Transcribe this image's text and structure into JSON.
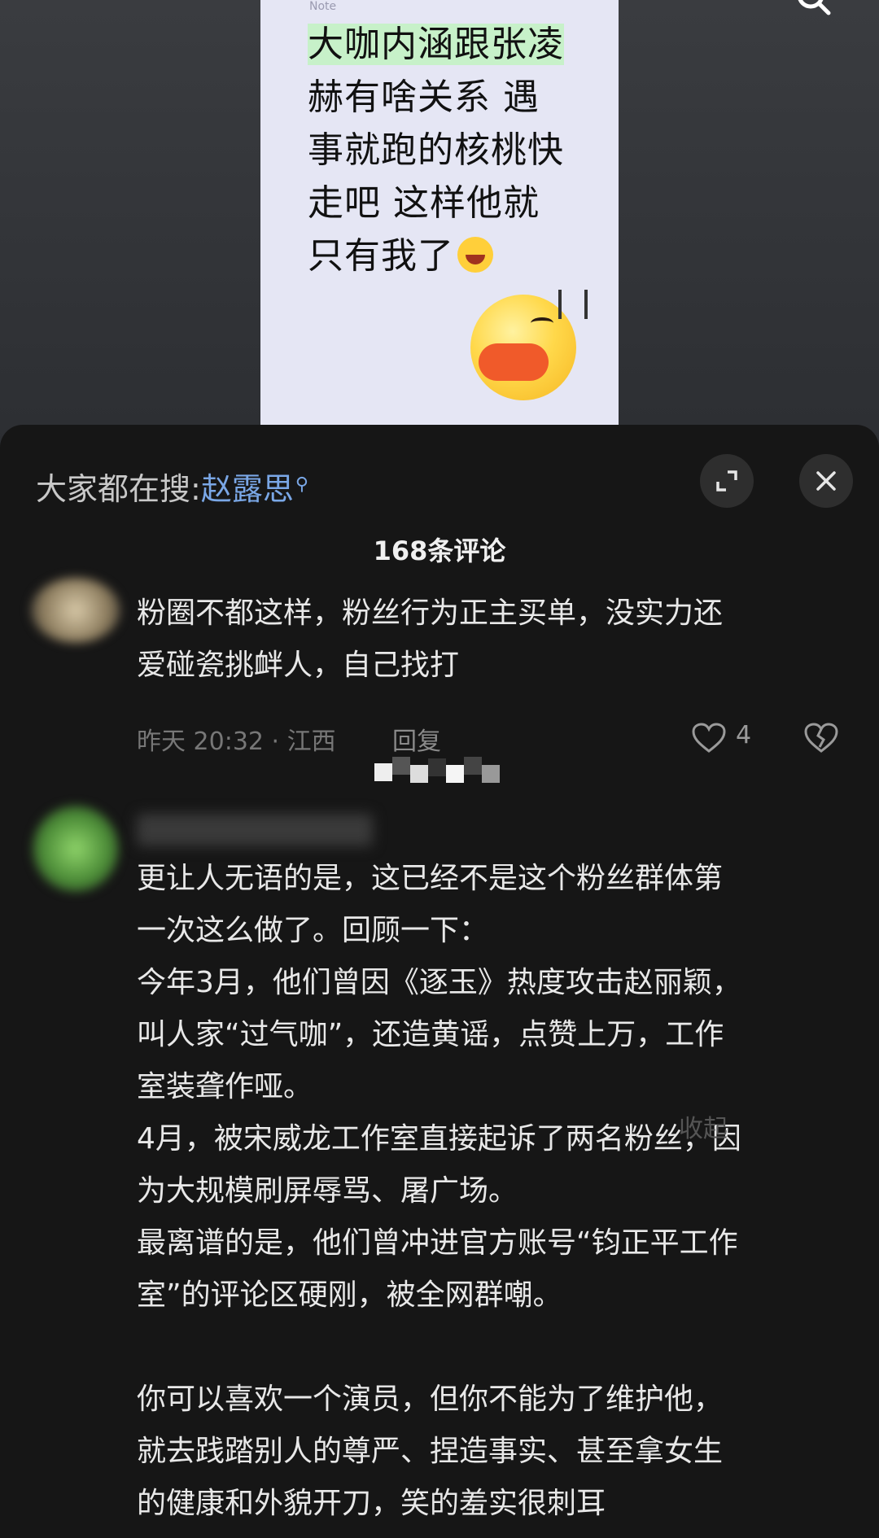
{
  "note": {
    "header_hint": "Note",
    "highlight_line": "大咖内涵跟张凌",
    "rest_lines": "赫有啥关系  遇\n事就跑的核桃快\n走吧 这样他就\n只有我了",
    "laugh_emoji_icon": "face-with-tears-of-joy",
    "duck_emoji_icon": "duck-face-sweat"
  },
  "top_bar": {
    "search_icon": "search-icon"
  },
  "sheet": {
    "trending_prefix": "大家都在搜:",
    "trending_keyword": "赵露思",
    "trending_search_glyph": "⚲",
    "count_title": "168条评论"
  },
  "comments": [
    {
      "text": "粉圈不都这样，粉丝行为正主买单，没实力还\n爱碰瓷挑衅人，自己找打",
      "time_location": "昨天 20:32 · 江西",
      "reply_label": "回复",
      "likes": "4"
    },
    {
      "text": "更让人无语的是，这已经不是这个粉丝群体第\n一次这么做了。回顾一下：\n今年3月，他们曾因《逐玉》热度攻击赵丽颖，\n叫人家“过气咖”，还造黄谣，点赞上万，工作\n室装聋作哑。\n4月，被宋威龙工作室直接起诉了两名粉丝，因\n为大规模刷屏辱骂、屠广场。\n最离谱的是，他们曾冲进官方账号“钧正平工作\n室”的评论区硬刚，被全网群嘲。\n\n你可以喜欢一个演员，但你不能为了维护他，\n就去践踏别人的尊严、捏造事实、甚至拿女生\n的健康和外貌开刀，笑的羞实很刺耳",
      "collapse_label": "收起"
    }
  ],
  "colors": {
    "sheet_bg": "#161616",
    "keyword": "#7aa7e6",
    "note_bg": "#e5e6f4",
    "highlight": "#c7f1c9"
  }
}
